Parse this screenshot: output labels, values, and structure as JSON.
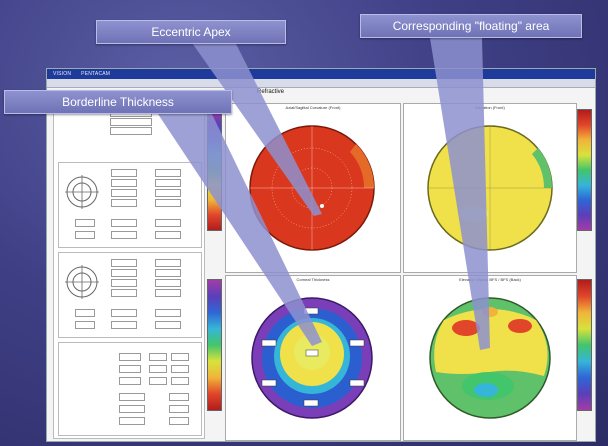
{
  "window": {
    "title_left": "VISION",
    "title_right": "PENTACAM",
    "section_title": "Refractive"
  },
  "callouts": {
    "eccentric_apex": "Eccentric Apex",
    "floating_area": "Corresponding \"floating\" area",
    "borderline_thickness": "Borderline Thickness"
  },
  "map_titles": {
    "sagittal": "Axial/Sagittal Curvature (Front)",
    "elevation_front": "Elevation (Front)",
    "thickness": "Corneal Thickness",
    "elevation_back": "Elevation (Back) BFS / BFS (Back)"
  },
  "colors": {
    "callout_bg": "#7a7ec0",
    "callout_arrow": "#8d90cf",
    "title_bar": "#1e3a9a",
    "sagittal_red": "#d9381e",
    "elevation_yellow": "#f0e04a",
    "thickness_blue": "#2b5fcf",
    "thickness_purple": "#7a3fb8"
  }
}
